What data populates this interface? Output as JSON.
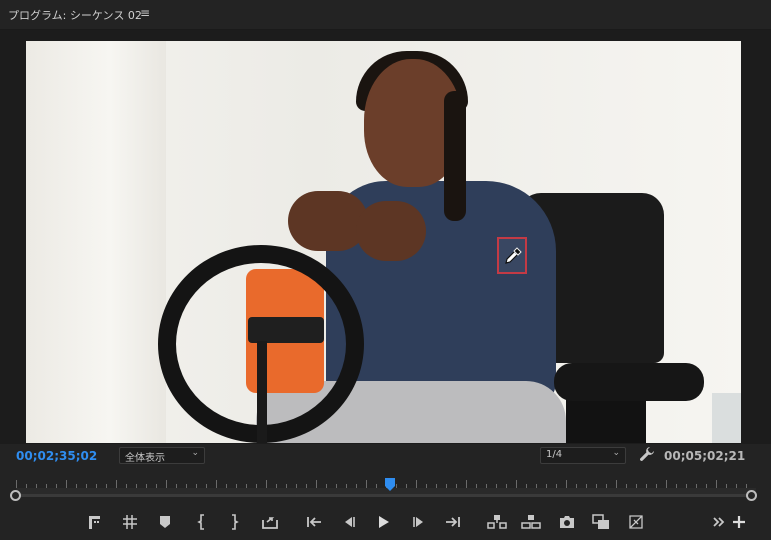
{
  "panel": {
    "title": "プログラム: シーケンス 02",
    "menu_glyph": "≡"
  },
  "viewer": {
    "timecode_current": "00;02;35;02",
    "zoom_value": "全体表示",
    "resolution_value": "1/4",
    "timecode_duration": "00;05;02;21",
    "playhead_position": 0.505,
    "colors": {
      "timecode_accent": "#2f8df0",
      "eyedropper_highlight": "#c33a45"
    }
  },
  "transport": {
    "icons": [
      "add-marker-icon",
      "go-to-in-marker-icon",
      "marker-icon",
      "mark-in-icon",
      "mark-out-icon",
      "export-frame-icon",
      "go-to-in-icon",
      "step-back-icon",
      "play-icon",
      "step-forward-icon",
      "go-to-out-icon",
      "lift-icon",
      "extract-icon",
      "camera-icon",
      "compare-view-icon",
      "proxy-toggle-icon",
      "more-icon",
      "add-button-icon"
    ]
  }
}
